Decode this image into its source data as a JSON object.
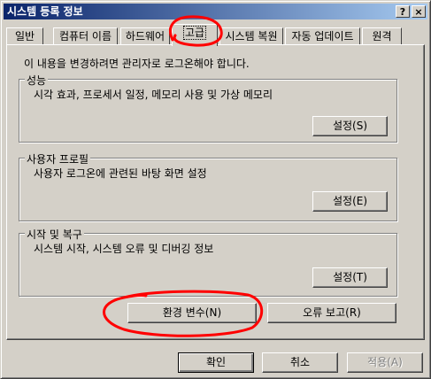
{
  "window": {
    "title": "시스템 등록 정보",
    "help_button": "?",
    "close_button": "×"
  },
  "tabs": [
    {
      "label": "일반"
    },
    {
      "label": "컴퓨터 이름"
    },
    {
      "label": "하드웨어"
    },
    {
      "label": "고급",
      "active": true
    },
    {
      "label": "시스템 복원"
    },
    {
      "label": "자동 업데이트"
    },
    {
      "label": "원격"
    }
  ],
  "advanced": {
    "note": "이 내용을 변경하려면 관리자로 로그온해야 합니다.",
    "groups": [
      {
        "legend": "성능",
        "description": "시각 효과, 프로세서 일정, 메모리 사용 및 가상 메모리",
        "button": "설정(S)"
      },
      {
        "legend": "사용자 프로필",
        "description": "사용자 로그온에 관련된 바탕 화면 설정",
        "button": "설정(E)"
      },
      {
        "legend": "시작 및 복구",
        "description": "시스템 시작, 시스템 오류 및 디버깅 정보",
        "button": "설정(T)"
      }
    ],
    "env_button": "환경 변수(N)",
    "error_report_button": "오류 보고(R)"
  },
  "footer": {
    "ok": "확인",
    "cancel": "취소",
    "apply": "적용(A)"
  },
  "annotation_color": "#ff0000"
}
